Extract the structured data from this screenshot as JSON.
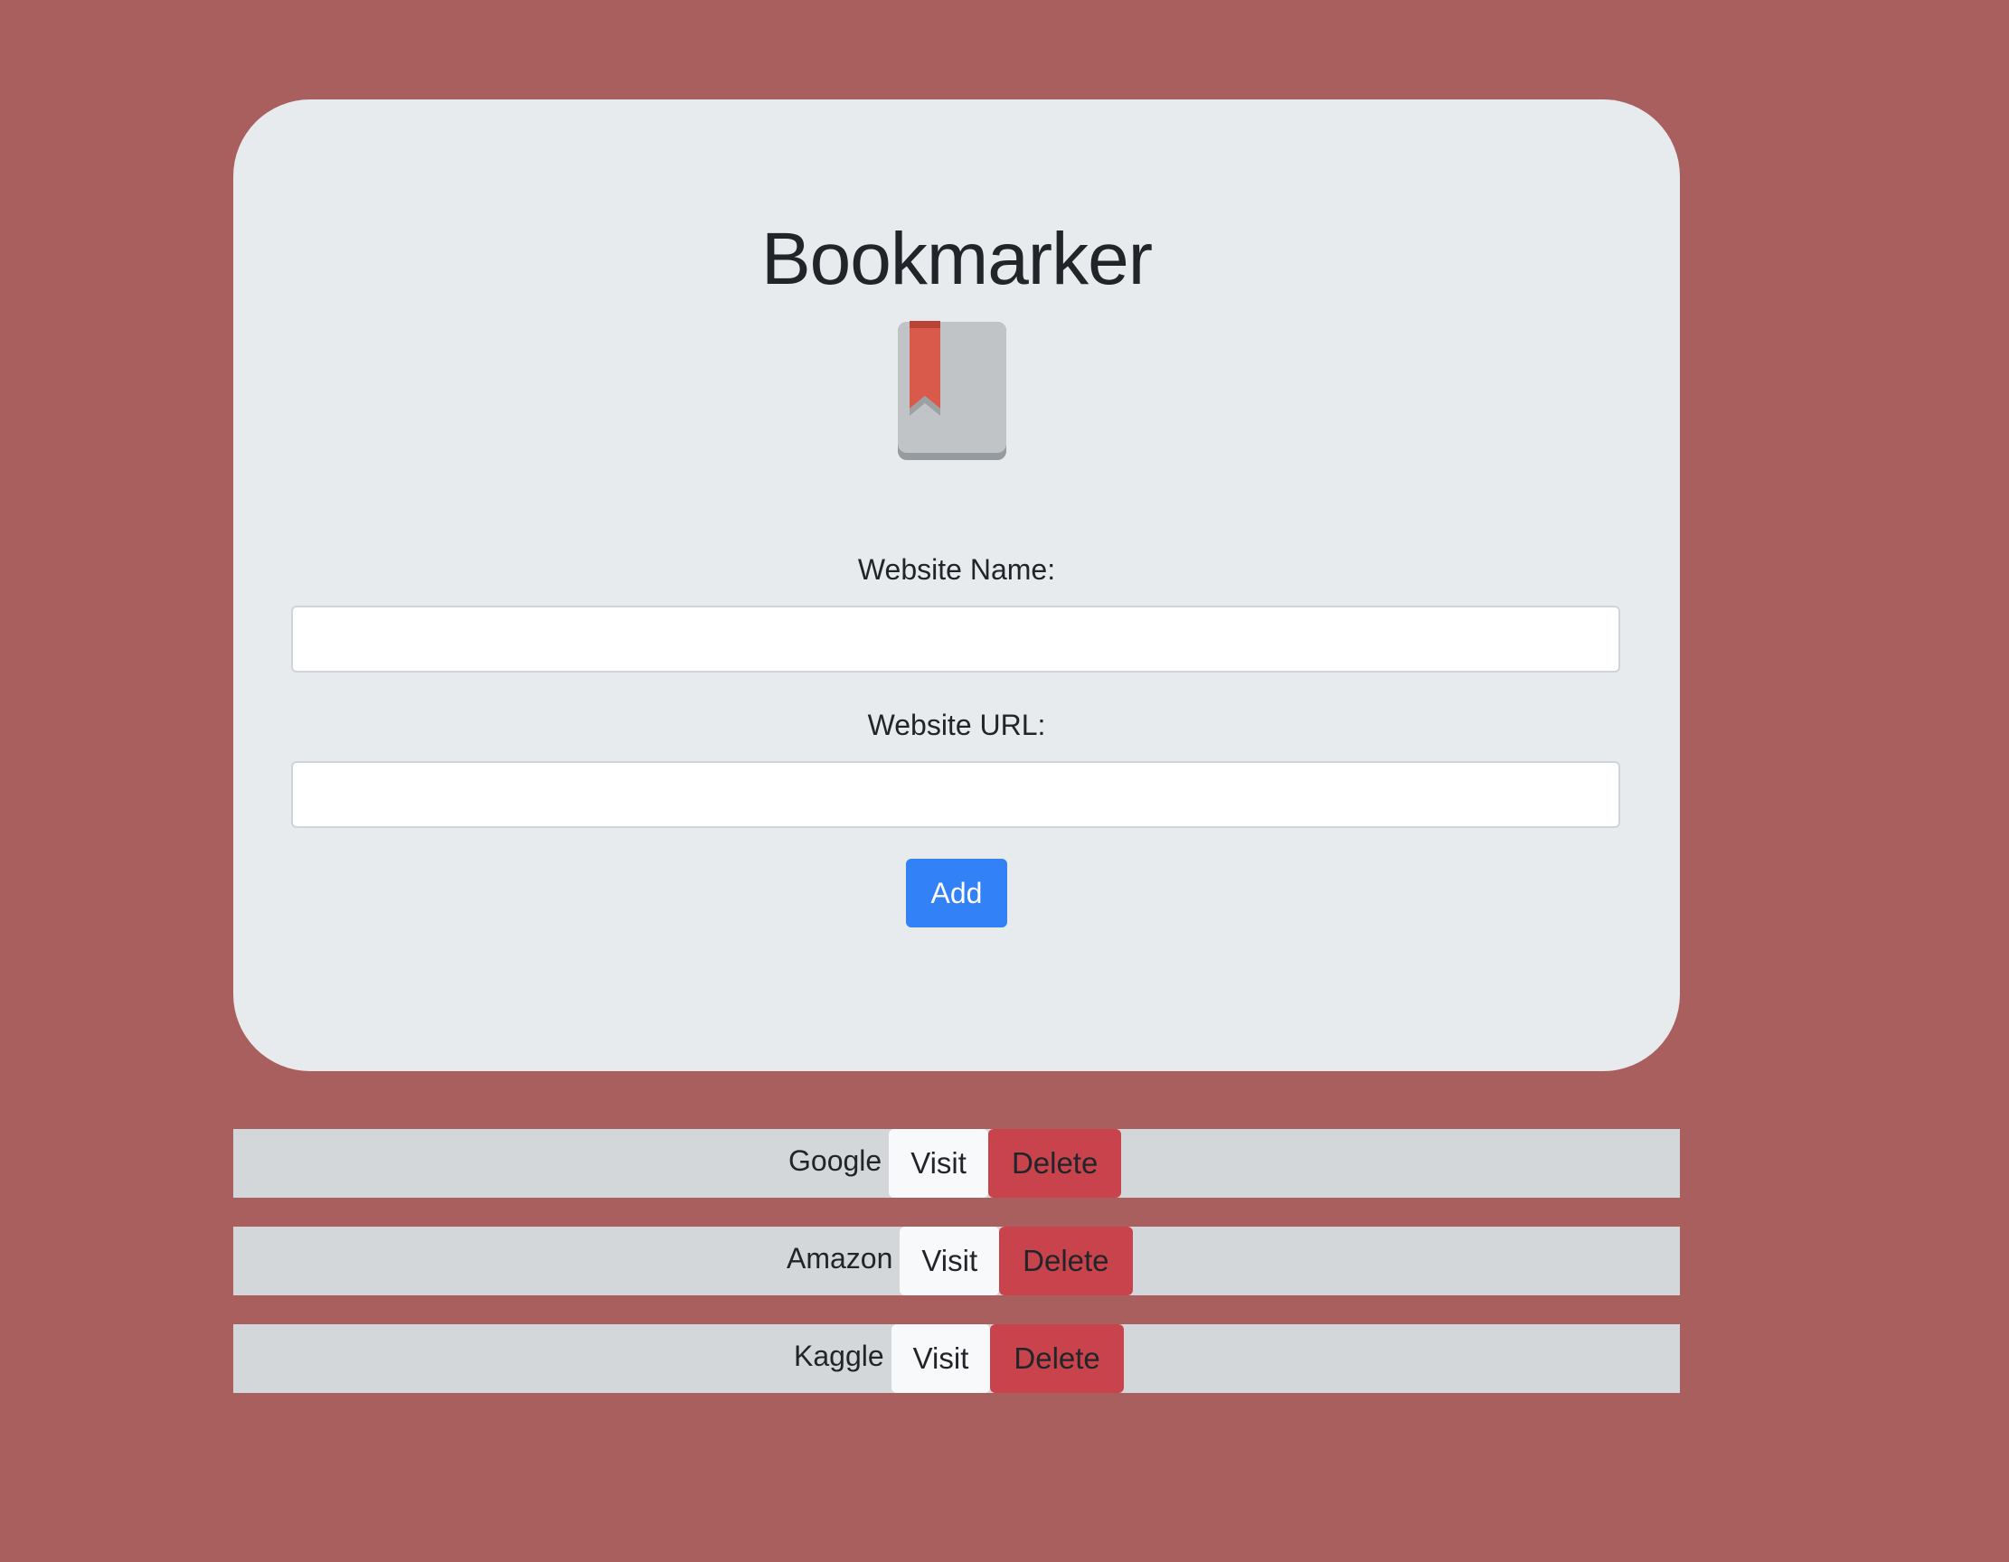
{
  "app": {
    "title": "Bookmarker",
    "icon": "bookmark-book-icon"
  },
  "form": {
    "name_label": "Website Name:",
    "name_value": "",
    "url_label": "Website URL:",
    "url_value": "",
    "add_label": "Add"
  },
  "bookmarks": [
    {
      "name": "Google",
      "visit_label": "Visit",
      "delete_label": "Delete"
    },
    {
      "name": "Amazon",
      "visit_label": "Visit",
      "delete_label": "Delete"
    },
    {
      "name": "Kaggle",
      "visit_label": "Visit",
      "delete_label": "Delete"
    }
  ],
  "colors": {
    "background": "#a95f5e",
    "card": "#e8ebee",
    "add_button": "#3381f7",
    "delete_button": "#c9434c",
    "row_background": "#d4d7da",
    "bookmark_ribbon": "#d95a4a"
  }
}
